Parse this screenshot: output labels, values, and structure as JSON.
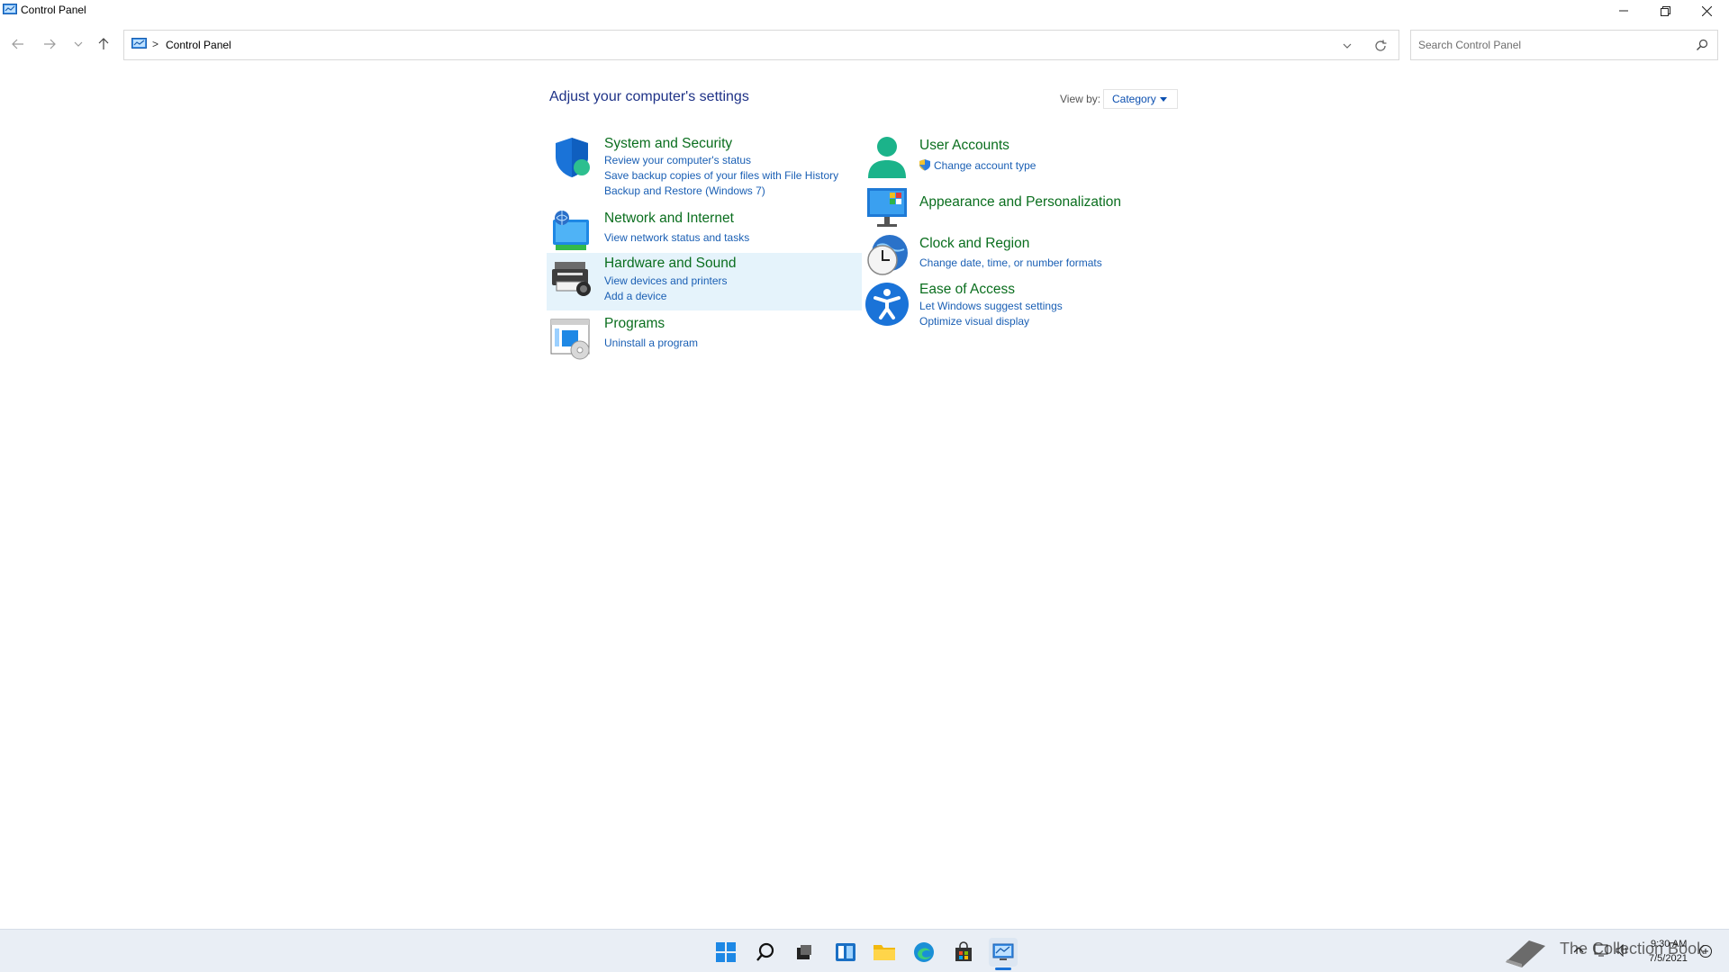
{
  "window": {
    "title": "Control Panel"
  },
  "address": {
    "breadcrumb": "Control Panel",
    "separator": ">"
  },
  "search": {
    "placeholder": "Search Control Panel"
  },
  "main": {
    "heading": "Adjust your computer's settings",
    "view_by_label": "View by:",
    "view_by_value": "Category"
  },
  "categories": {
    "system_security": {
      "title": "System and Security",
      "links": [
        "Review your computer's status",
        "Save backup copies of your files with File History",
        "Backup and Restore (Windows 7)"
      ]
    },
    "network": {
      "title": "Network and Internet",
      "links": [
        "View network status and tasks"
      ]
    },
    "hardware": {
      "title": "Hardware and Sound",
      "links": [
        "View devices and printers",
        "Add a device"
      ]
    },
    "programs": {
      "title": "Programs",
      "links": [
        "Uninstall a program"
      ]
    },
    "user_accounts": {
      "title": "User Accounts",
      "links": [
        "Change account type"
      ]
    },
    "appearance": {
      "title": "Appearance and Personalization",
      "links": []
    },
    "clock": {
      "title": "Clock and Region",
      "links": [
        "Change date, time, or number formats"
      ]
    },
    "ease": {
      "title": "Ease of Access",
      "links": [
        "Let Windows suggest settings",
        "Optimize visual display"
      ]
    }
  },
  "taskbar": {
    "time": "9:30 AM",
    "date": "7/5/2021",
    "watermark": "The Collection Book"
  },
  "colors": {
    "accent": "#0b4fb0",
    "category_title": "#0a6e1e",
    "link": "#1a5fb4",
    "heading": "#1e3287",
    "taskbar": "#e9eef5"
  }
}
